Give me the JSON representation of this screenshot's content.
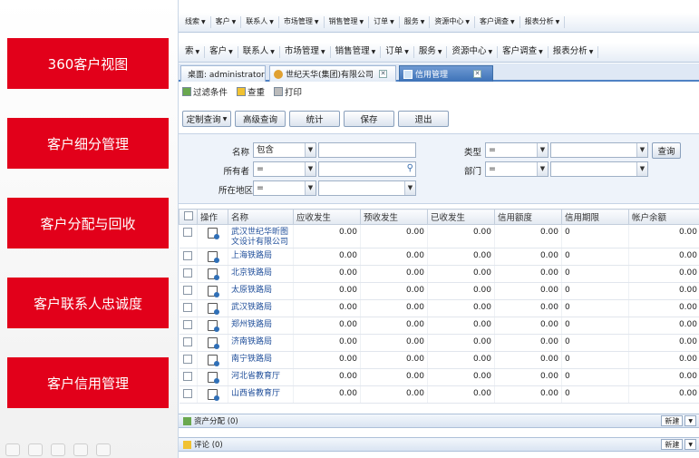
{
  "slide": {
    "buttons": [
      "360客户视图",
      "客户细分管理",
      "客户分配与回收",
      "客户联系人忠诚度",
      "客户信用管理"
    ]
  },
  "top_menu": [
    {
      "label": "线索"
    },
    {
      "label": "客户"
    },
    {
      "label": "联系人"
    },
    {
      "label": "市场管理"
    },
    {
      "label": "销售管理"
    },
    {
      "label": "订单"
    },
    {
      "label": "服务"
    },
    {
      "label": "资源中心"
    },
    {
      "label": "客户调查"
    },
    {
      "label": "报表分析"
    }
  ],
  "main_menu": [
    {
      "label": "索"
    },
    {
      "label": "客户"
    },
    {
      "label": "联系人"
    },
    {
      "label": "市场管理"
    },
    {
      "label": "销售管理"
    },
    {
      "label": "订单"
    },
    {
      "label": "服务"
    },
    {
      "label": "资源中心"
    },
    {
      "label": "客户调查"
    },
    {
      "label": "报表分析"
    }
  ],
  "tabs": [
    {
      "label": "桌面: administrator"
    },
    {
      "label": "世纪天华(集团)有限公司"
    },
    {
      "label": "信用管理"
    }
  ],
  "toolbar": {
    "filter": "过滤条件",
    "query": "查重",
    "print": "打印"
  },
  "buttons": {
    "custom": "定制查询",
    "advanced": "高级查询",
    "stats": "统计",
    "save": "保存",
    "exit": "退出"
  },
  "filter": {
    "name_label": "名称",
    "name_op": "包含",
    "owner_label": "所有者",
    "owner_op": "=",
    "region_label": "所在地区",
    "region_op": "=",
    "type_label": "类型",
    "type_op": "=",
    "dept_label": "部门",
    "dept_op": "=",
    "query_button": "查询"
  },
  "table": {
    "headers": [
      "",
      "操作",
      "名称",
      "应收发生",
      "预收发生",
      "已收发生",
      "信用额度",
      "信用期限",
      "帐户余额"
    ],
    "rows": [
      {
        "name": "武汉世纪华昕图文设计有限公司",
        "ar": "0.00",
        "adv": "0.00",
        "rec": "0.00",
        "limit": "0.00",
        "term": "0",
        "balance": "0.00"
      },
      {
        "name": "上海铁路局",
        "ar": "0.00",
        "adv": "0.00",
        "rec": "0.00",
        "limit": "0.00",
        "term": "0",
        "balance": "0.00"
      },
      {
        "name": "北京铁路局",
        "ar": "0.00",
        "adv": "0.00",
        "rec": "0.00",
        "limit": "0.00",
        "term": "0",
        "balance": "0.00"
      },
      {
        "name": "太原铁路局",
        "ar": "0.00",
        "adv": "0.00",
        "rec": "0.00",
        "limit": "0.00",
        "term": "0",
        "balance": "0.00"
      },
      {
        "name": "武汉铁路局",
        "ar": "0.00",
        "adv": "0.00",
        "rec": "0.00",
        "limit": "0.00",
        "term": "0",
        "balance": "0.00"
      },
      {
        "name": "郑州铁路局",
        "ar": "0.00",
        "adv": "0.00",
        "rec": "0.00",
        "limit": "0.00",
        "term": "0",
        "balance": "0.00"
      },
      {
        "name": "济南铁路局",
        "ar": "0.00",
        "adv": "0.00",
        "rec": "0.00",
        "limit": "0.00",
        "term": "0",
        "balance": "0.00"
      },
      {
        "name": "南宁铁路局",
        "ar": "0.00",
        "adv": "0.00",
        "rec": "0.00",
        "limit": "0.00",
        "term": "0",
        "balance": "0.00"
      },
      {
        "name": "河北省教育厅",
        "ar": "0.00",
        "adv": "0.00",
        "rec": "0.00",
        "limit": "0.00",
        "term": "0",
        "balance": "0.00"
      },
      {
        "name": "山西省教育厅",
        "ar": "0.00",
        "adv": "0.00",
        "rec": "0.00",
        "limit": "0.00",
        "term": "0",
        "balance": "0.00"
      }
    ]
  },
  "panels": {
    "assets": "资产分配 (0)",
    "comments": "评论 (0)",
    "new_label": "新建"
  },
  "colors": {
    "accent_red": "#e2001a",
    "link_blue": "#1f4e9a",
    "tab_active": "#3d72b8"
  }
}
